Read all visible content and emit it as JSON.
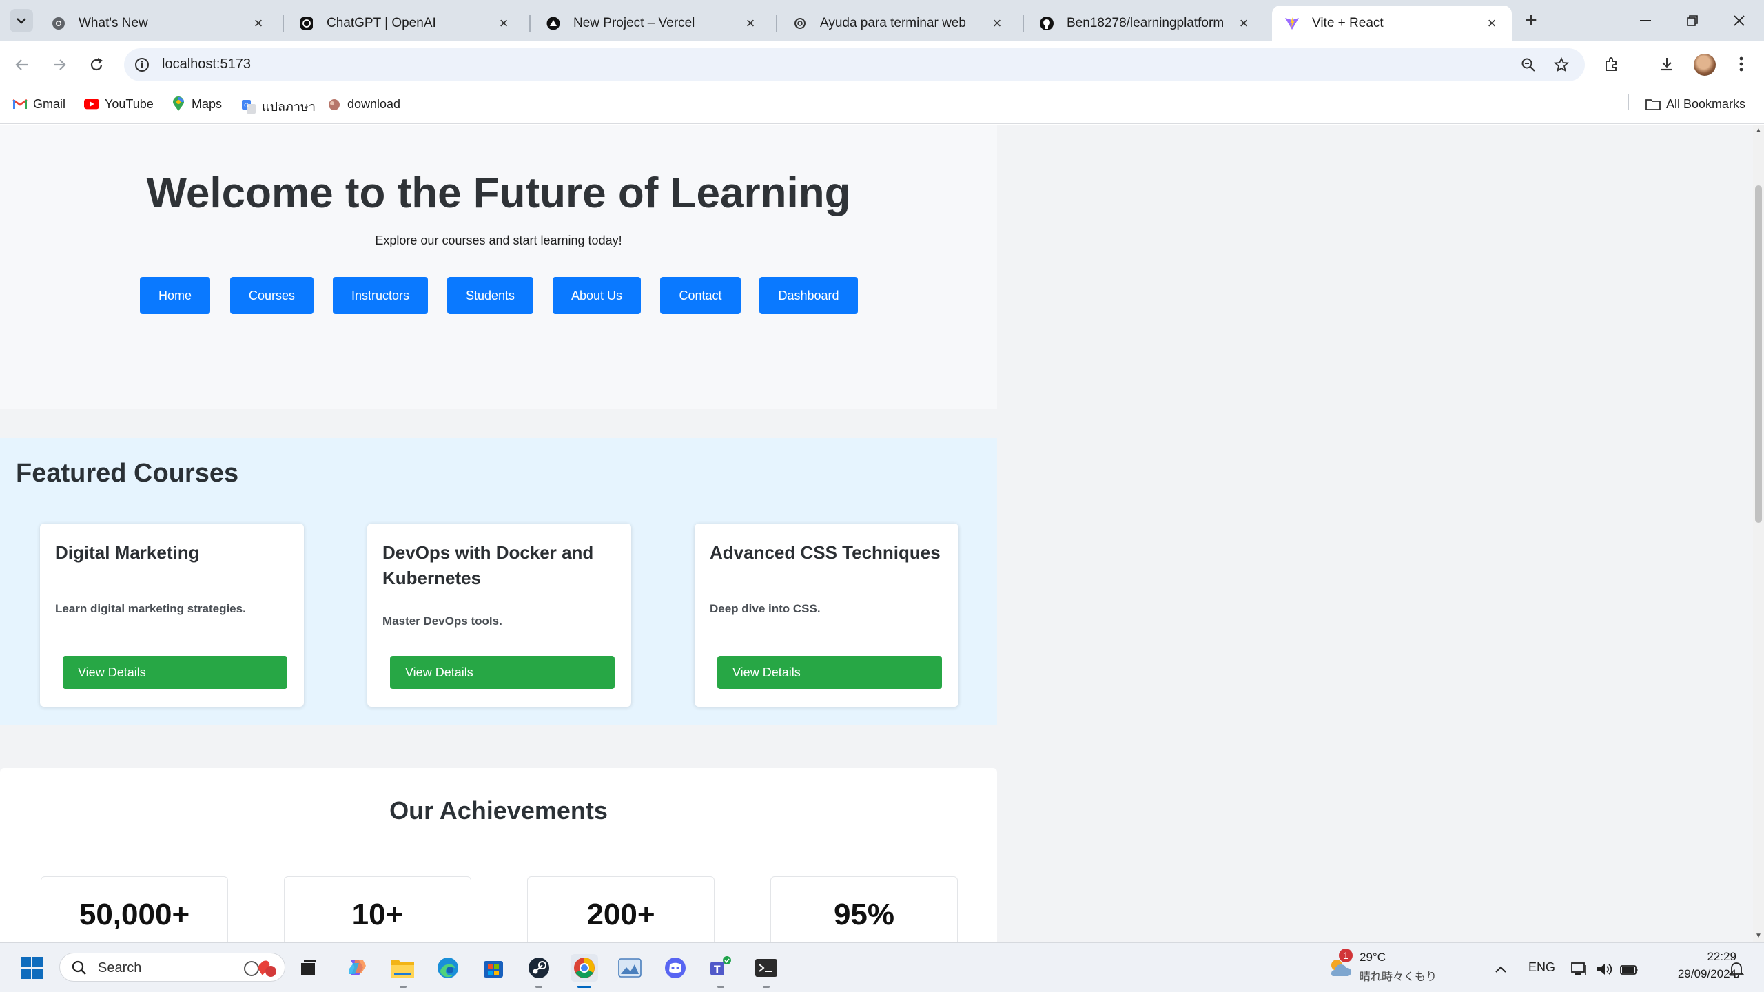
{
  "browser": {
    "tabs": [
      {
        "title": "What's New",
        "icon": "chrome-icon"
      },
      {
        "title": "ChatGPT | OpenAI",
        "icon": "openai-icon"
      },
      {
        "title": "New Project – Vercel",
        "icon": "vercel-icon"
      },
      {
        "title": "Ayuda para terminar web",
        "icon": "openai-icon"
      },
      {
        "title": "Ben18278/learningplatform",
        "icon": "github-icon"
      },
      {
        "title": "Vite + React",
        "icon": "vite-icon",
        "active": true
      }
    ],
    "address": "localhost:5173",
    "bookmarks": [
      {
        "label": "Gmail",
        "icon": "gmail-icon"
      },
      {
        "label": "YouTube",
        "icon": "youtube-icon"
      },
      {
        "label": "Maps",
        "icon": "maps-icon"
      },
      {
        "label": "แปลภาษา",
        "icon": "translate-icon"
      },
      {
        "label": "download",
        "icon": "download-bookmark-icon"
      }
    ],
    "all_bookmarks": "All Bookmarks"
  },
  "hero": {
    "title": "Welcome to the Future of Learning",
    "subtitle": "Explore our courses and start learning today!",
    "nav": [
      "Home",
      "Courses",
      "Instructors",
      "Students",
      "About Us",
      "Contact",
      "Dashboard"
    ]
  },
  "featured": {
    "title": "Featured Courses",
    "courses": [
      {
        "name": "Digital Marketing",
        "description": "Learn digital marketing strategies.",
        "button": "View Details"
      },
      {
        "name": "DevOps with Docker and Kubernetes",
        "description": "Master DevOps tools.",
        "button": "View Details"
      },
      {
        "name": "Advanced CSS Techniques",
        "description": "Deep dive into CSS.",
        "button": "View Details"
      }
    ]
  },
  "achievements": {
    "title": "Our Achievements",
    "stats": [
      "50,000+",
      "10+",
      "200+",
      "95%"
    ]
  },
  "taskbar": {
    "search_placeholder": "Search",
    "weather": {
      "temp": "29°C",
      "desc": "晴れ時々くもり",
      "alert_count": "1"
    },
    "language": "ENG",
    "time": "22:29",
    "date": "29/09/2024"
  },
  "colors": {
    "primary": "#0a79ff",
    "success": "#27a745",
    "featured_bg": "#e6f4fe"
  }
}
